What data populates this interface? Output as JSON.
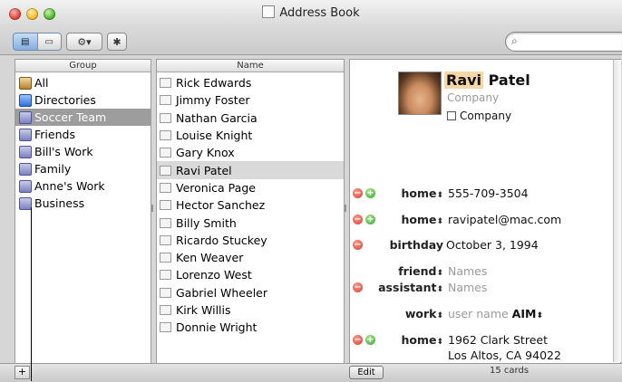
{
  "window": {
    "title": "Address Book"
  },
  "toolbar": {
    "view_card_and_columns": "card-columns-icon",
    "view_card_only": "card-only-icon",
    "action_menu": "gear-icon",
    "bluetooth": "bluetooth-icon",
    "search_placeholder": ""
  },
  "groups": {
    "header": "Group",
    "items": [
      {
        "label": "All",
        "icon": "all-cards-icon",
        "selected": false
      },
      {
        "label": "Directories",
        "icon": "directories-icon",
        "selected": false
      },
      {
        "label": "Soccer Team",
        "icon": "group-icon",
        "selected": true
      },
      {
        "label": "Friends",
        "icon": "group-icon",
        "selected": false
      },
      {
        "label": "Bill's Work",
        "icon": "group-icon",
        "selected": false
      },
      {
        "label": "Family",
        "icon": "group-icon",
        "selected": false
      },
      {
        "label": "Anne's Work",
        "icon": "group-icon",
        "selected": false
      },
      {
        "label": "Business",
        "icon": "group-icon",
        "selected": false
      }
    ]
  },
  "names": {
    "header": "Name",
    "items": [
      {
        "label": "Rick Edwards",
        "selected": false
      },
      {
        "label": "Jimmy Foster",
        "selected": false
      },
      {
        "label": "Nathan Garcia",
        "selected": false
      },
      {
        "label": "Louise Knight",
        "selected": false
      },
      {
        "label": "Gary Knox",
        "selected": false
      },
      {
        "label": "Ravi Patel",
        "selected": true
      },
      {
        "label": "Veronica Page",
        "selected": false
      },
      {
        "label": "Hector Sanchez",
        "selected": false
      },
      {
        "label": "Billy Smith",
        "selected": false
      },
      {
        "label": "Ricardo Stuckey",
        "selected": false
      },
      {
        "label": "Ken Weaver",
        "selected": false
      },
      {
        "label": "Lorenzo West",
        "selected": false
      },
      {
        "label": "Gabriel Wheeler",
        "selected": false
      },
      {
        "label": "Kirk Willis",
        "selected": false
      },
      {
        "label": "Donnie Wright",
        "selected": false
      }
    ]
  },
  "card": {
    "first_name": "Ravi",
    "last_name": "Patel",
    "company_placeholder": "Company",
    "company_checkbox_label": "Company",
    "phone": {
      "label": "home",
      "value": "555-709-3504"
    },
    "email": {
      "label": "home",
      "value": "ravipatel@mac.com"
    },
    "birthday": {
      "label": "birthday",
      "value": "October 3, 1994"
    },
    "friend": {
      "label": "friend",
      "placeholder": "Names"
    },
    "assistant": {
      "label": "assistant",
      "placeholder": "Names"
    },
    "im": {
      "label": "work",
      "placeholder": "user name",
      "service": "AIM"
    },
    "address": {
      "label": "home",
      "line1": "1962 Clark Street",
      "line2": "Los Altos, CA 94022"
    }
  },
  "footer": {
    "add_label": "+",
    "edit_label": "Edit",
    "card_count": "15 cards"
  }
}
